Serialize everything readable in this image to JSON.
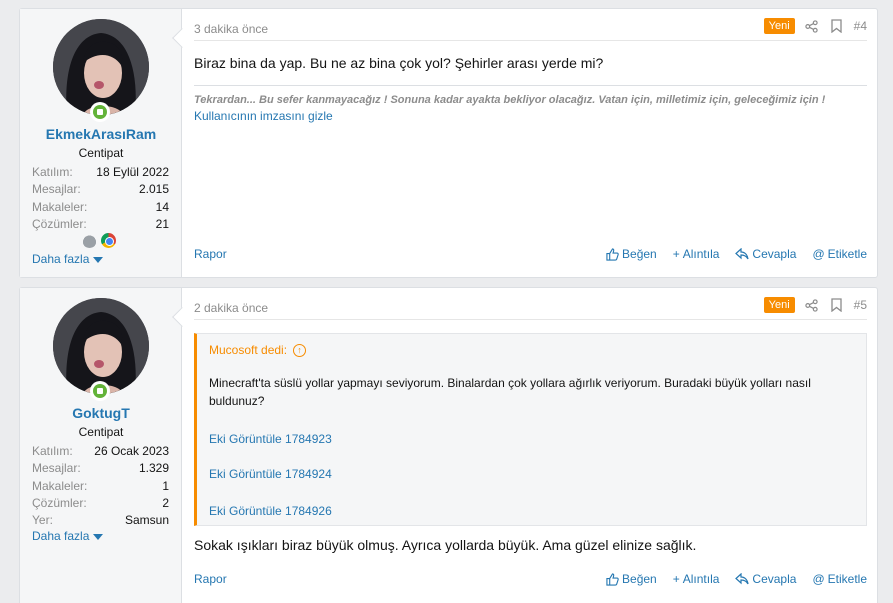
{
  "posts": [
    {
      "username": "EkmekArasıRam",
      "user_title": "Centipat",
      "stats": [
        {
          "k": "Katılım:",
          "v": "18 Eylül 2022"
        },
        {
          "k": "Mesajlar:",
          "v": "2.015"
        },
        {
          "k": "Makaleler:",
          "v": "14"
        },
        {
          "k": "Çözümler:",
          "v": "21"
        }
      ],
      "more_label": "Daha fazla",
      "time": "3 dakika önce",
      "badge": "Yeni",
      "number": "#4",
      "body": "Biraz bina da yap. Bu ne az bina çok yol? Şehirler arası yerde mi?",
      "signature": "Tekrardan... Bu sefer kanmayacağız ! Sonuna kadar ayakta bekliyor olacağız. Vatan için, milletimiz için, geleceğimiz için !",
      "signature_toggle": "Kullanıcının imzasını gizle",
      "actions": {
        "report": "Rapor",
        "like": "Beğen",
        "quote": "Alıntıla",
        "reply": "Cevapla",
        "tag": "Etiketle"
      }
    },
    {
      "username": "GoktugT",
      "user_title": "Centipat",
      "stats": [
        {
          "k": "Katılım:",
          "v": "26 Ocak 2023"
        },
        {
          "k": "Mesajlar:",
          "v": "1.329"
        },
        {
          "k": "Makaleler:",
          "v": "1"
        },
        {
          "k": "Çözümler:",
          "v": "2"
        },
        {
          "k": "Yer:",
          "v": "Samsun"
        }
      ],
      "more_label": "Daha fazla",
      "time": "2 dakika önce",
      "badge": "Yeni",
      "number": "#5",
      "quote_author": "Mucosoft dedi:",
      "quote_text": "Minecraft'ta süslü yollar yapmayı seviyorum. Binalardan çok yollara ağırlık veriyorum. Buradaki büyük yolları nasıl buldunuz?",
      "quote_links": [
        "Eki Görüntüle 1784923",
        "Eki Görüntüle 1784924",
        "Eki Görüntüle 1784926"
      ],
      "body": "Sokak ışıkları biraz büyük olmuş. Ayrıca yollarda büyük. Ama güzel elinize sağlık.",
      "actions": {
        "report": "Rapor",
        "like": "Beğen",
        "quote": "Alıntıla",
        "reply": "Cevapla",
        "tag": "Etiketle"
      }
    }
  ],
  "colors": {
    "accent": "#2577b1",
    "badge": "#f78c00",
    "online": "#63b339"
  }
}
